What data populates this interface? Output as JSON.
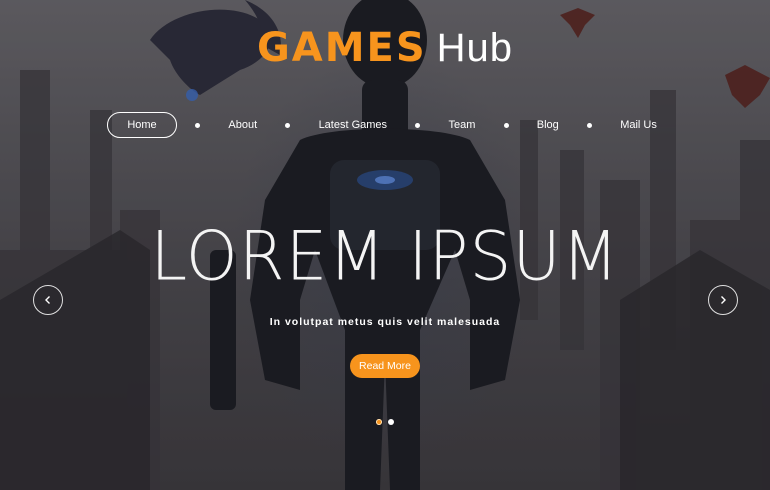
{
  "brand": {
    "name_accent": "GAMES",
    "name_rest": "Hub"
  },
  "nav": {
    "items": [
      {
        "label": "Home",
        "active": true
      },
      {
        "label": "About"
      },
      {
        "label": "Latest Games"
      },
      {
        "label": "Team"
      },
      {
        "label": "Blog"
      },
      {
        "label": "Mail Us"
      }
    ]
  },
  "hero": {
    "title": "LOREM IPSUM",
    "subtitle": "In volutpat metus quis velit malesuada",
    "cta_label": "Read More",
    "prev_icon": "chevron-left-icon",
    "next_icon": "chevron-right-icon",
    "slides_total": 2,
    "active_slide": 1
  },
  "colors": {
    "accent": "#f7941d",
    "text": "#ffffff"
  }
}
